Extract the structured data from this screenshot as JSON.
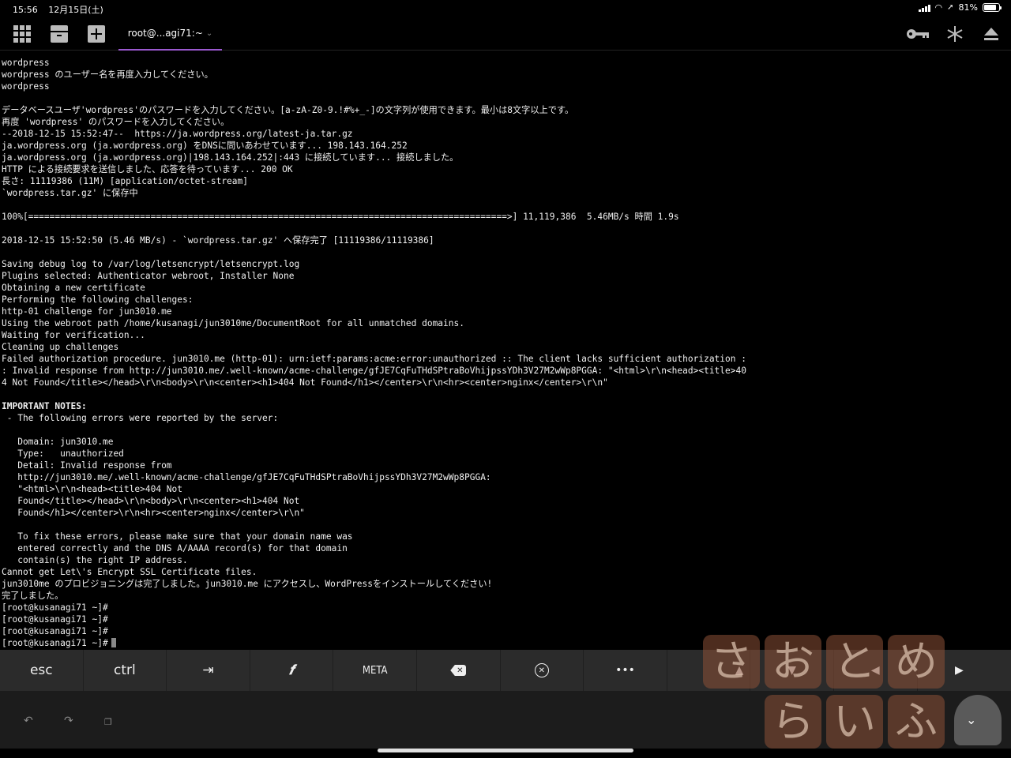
{
  "status_bar": {
    "time": "15:56",
    "date": "12月15日(土)",
    "battery_percent": "81%",
    "battery_level": 0.81
  },
  "top_bar": {
    "tab_title": "root@...agi71:~"
  },
  "terminal": {
    "lines": [
      "wordpress",
      "wordpress のユーザー名を再度入力してください。",
      "wordpress",
      "",
      "データベースユーザ'wordpress'のパスワードを入力してください。[a-zA-Z0-9.!#%+_-]の文字列が使用できます。最小は8文字以上です。",
      "再度 'wordpress' のパスワードを入力してください。",
      "--2018-12-15 15:52:47--  https://ja.wordpress.org/latest-ja.tar.gz",
      "ja.wordpress.org (ja.wordpress.org) をDNSに問いあわせています... 198.143.164.252",
      "ja.wordpress.org (ja.wordpress.org)|198.143.164.252|:443 に接続しています... 接続しました。",
      "HTTP による接続要求を送信しました、応答を待っています... 200 OK",
      "長さ: 11119386 (11M) [application/octet-stream]",
      "`wordpress.tar.gz' に保存中",
      "",
      "100%[==========================================================================================>] 11,119,386  5.46MB/s 時間 1.9s",
      "",
      "2018-12-15 15:52:50 (5.46 MB/s) - `wordpress.tar.gz' へ保存完了 [11119386/11119386]",
      "",
      "Saving debug log to /var/log/letsencrypt/letsencrypt.log",
      "Plugins selected: Authenticator webroot, Installer None",
      "Obtaining a new certificate",
      "Performing the following challenges:",
      "http-01 challenge for jun3010.me",
      "Using the webroot path /home/kusanagi/jun3010me/DocumentRoot for all unmatched domains.",
      "Waiting for verification...",
      "Cleaning up challenges",
      "Failed authorization procedure. jun3010.me (http-01): urn:ietf:params:acme:error:unauthorized :: The client lacks sufficient authorization :",
      ": Invalid response from http://jun3010.me/.well-known/acme-challenge/gfJE7CqFuTHdSPtraBoVhijpssYDh3V27M2wWp8PGGA: \"<html>\\r\\n<head><title>40",
      "4 Not Found</title></head>\\r\\n<body>\\r\\n<center><h1>404 Not Found</h1></center>\\r\\n<hr><center>nginx</center>\\r\\n\"",
      "",
      "IMPORTANT NOTES:",
      " - The following errors were reported by the server:",
      "",
      "   Domain: jun3010.me",
      "   Type:   unauthorized",
      "   Detail: Invalid response from",
      "   http://jun3010.me/.well-known/acme-challenge/gfJE7CqFuTHdSPtraBoVhijpssYDh3V27M2wWp8PGGA:",
      "   \"<html>\\r\\n<head><title>404 Not",
      "   Found</title></head>\\r\\n<body>\\r\\n<center><h1>404 Not",
      "   Found</h1></center>\\r\\n<hr><center>nginx</center>\\r\\n\"",
      "",
      "   To fix these errors, please make sure that your domain name was",
      "   entered correctly and the DNS A/AAAA record(s) for that domain",
      "   contain(s) the right IP address.",
      "Cannot get Let\\'s Encrypt SSL Certificate files.",
      "jun3010me のプロビジョニングは完了しました。jun3010.me にアクセスし、WordPressをインストールしてください!",
      "完了しました。",
      "[root@kusanagi71 ~]#",
      "[root@kusanagi71 ~]#",
      "[root@kusanagi71 ~]#",
      "[root@kusanagi71 ~]#"
    ]
  },
  "key_bar": {
    "keys": [
      "esc",
      "ctrl",
      "⇥",
      "𝒇",
      "META",
      "⌫",
      "⊗",
      "•••",
      "▲",
      "▼",
      "◀",
      "▶"
    ]
  },
  "shortcut_bar": {
    "undo": "↶",
    "redo": "↷",
    "copy": "❐"
  },
  "watermark": {
    "row1": [
      "さ",
      "お",
      "と",
      "め"
    ],
    "row2": [
      "ら",
      "い",
      "ふ"
    ],
    "hide_glyph": "⌄"
  },
  "colors": {
    "tab_accent": "#9b59d0",
    "key_bar_bg": "#2b2b2b",
    "terminal_bg": "#000000"
  }
}
